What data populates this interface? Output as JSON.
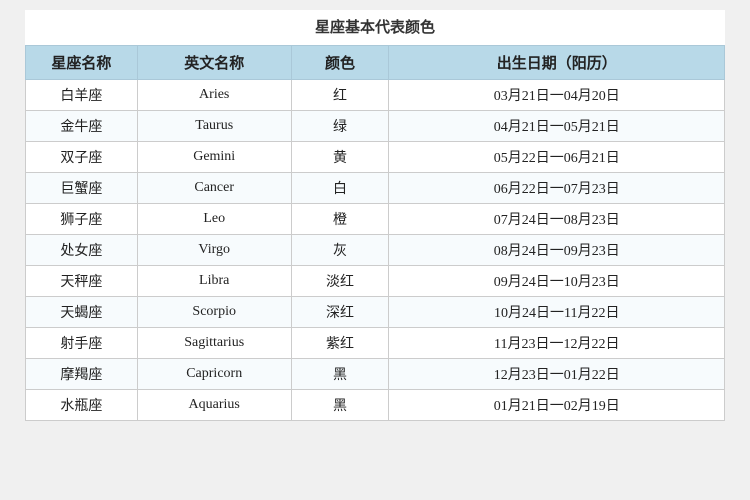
{
  "title": "星座基本代表颜色",
  "headers": {
    "zh_name": "星座名称",
    "en_name": "英文名称",
    "color": "颜色",
    "date": "出生日期（阳历）"
  },
  "rows": [
    {
      "zh": "白羊座",
      "en": "Aries",
      "color": "红",
      "date": "03月21日一04月20日"
    },
    {
      "zh": "金牛座",
      "en": "Taurus",
      "color": "绿",
      "date": "04月21日一05月21日"
    },
    {
      "zh": "双子座",
      "en": "Gemini",
      "color": "黄",
      "date": "05月22日一06月21日"
    },
    {
      "zh": "巨蟹座",
      "en": "Cancer",
      "color": "白",
      "date": "06月22日一07月23日"
    },
    {
      "zh": "狮子座",
      "en": "Leo",
      "color": "橙",
      "date": "07月24日一08月23日"
    },
    {
      "zh": "处女座",
      "en": "Virgo",
      "color": "灰",
      "date": "08月24日一09月23日"
    },
    {
      "zh": "天秤座",
      "en": "Libra",
      "color": "淡红",
      "date": "09月24日一10月23日"
    },
    {
      "zh": "天蝎座",
      "en": "Scorpio",
      "color": "深红",
      "date": "10月24日一11月22日"
    },
    {
      "zh": "射手座",
      "en": "Sagittarius",
      "color": "紫红",
      "date": "11月23日一12月22日"
    },
    {
      "zh": "摩羯座",
      "en": "Capricorn",
      "color": "黑",
      "date": "12月23日一01月22日"
    },
    {
      "zh": "水瓶座",
      "en": "Aquarius",
      "color": "黑",
      "date": "01月21日一02月19日"
    }
  ]
}
